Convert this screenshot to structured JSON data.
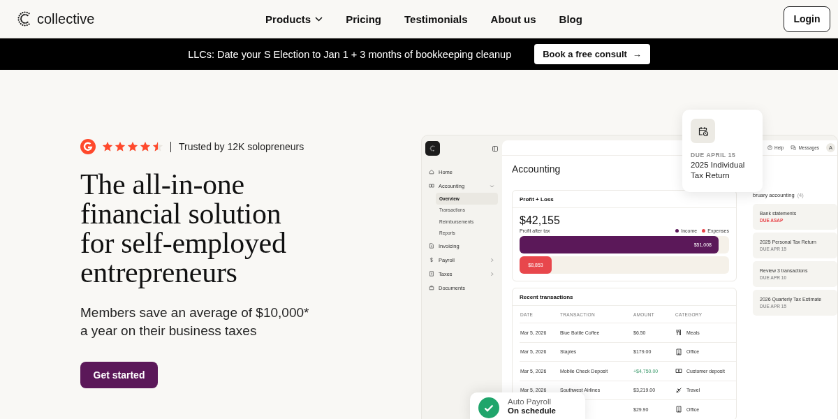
{
  "header": {
    "brand": "collective",
    "nav": [
      {
        "label": "Products",
        "dropdown": true
      },
      {
        "label": "Pricing",
        "dropdown": false
      },
      {
        "label": "Testimonials",
        "dropdown": false
      },
      {
        "label": "About us",
        "dropdown": false
      },
      {
        "label": "Blog",
        "dropdown": false
      }
    ],
    "login": "Login"
  },
  "banner": {
    "text": "LLCs: Date your S Election to Jan 1 + 3 months of bookkeeping cleanup",
    "button": "Book a free consult",
    "arrow": "→"
  },
  "hero": {
    "rating": {
      "stars": 4.5,
      "trust": "Trusted by 12K solopreneurs"
    },
    "title": "The all-in-one financial solution for self-employed entrepreneurs",
    "subtitle": "Members save an average of $10,000* a year on their business taxes",
    "cta": "Get started"
  },
  "app": {
    "sidebar": [
      {
        "label": "Home",
        "selected": false
      },
      {
        "label": "Accounting",
        "selected": false,
        "expanded": true,
        "children": [
          {
            "label": "Overview",
            "selected": true
          },
          {
            "label": "Transactions",
            "selected": false
          },
          {
            "label": "Reimbursements",
            "selected": false
          },
          {
            "label": "Reports",
            "selected": false
          }
        ]
      },
      {
        "label": "Invoicing",
        "selected": false
      },
      {
        "label": "Payroll",
        "selected": false,
        "expanded": false
      },
      {
        "label": "Taxes",
        "selected": false,
        "expanded": false
      },
      {
        "label": "Documents",
        "selected": false
      }
    ],
    "topbar": {
      "help": "Help",
      "messages": "Messages",
      "avatar": "A"
    },
    "page_title": "Accounting",
    "profit_loss": {
      "title": "Profit + Loss",
      "total": "$42,155",
      "caption": "Profit after tax",
      "legend": [
        {
          "label": "Income",
          "color": "#5b1859"
        },
        {
          "label": "Expenses",
          "color": "#e8474c"
        }
      ],
      "bars": [
        {
          "label": "$51,008",
          "level": 0.95
        },
        {
          "label": "$8,853",
          "level": 0.15
        }
      ]
    },
    "transactions": {
      "title": "Recent transactions",
      "columns": [
        "DATE",
        "TRANSACTION",
        "AMOUNT",
        "CATEGORY"
      ],
      "rows": [
        {
          "date": "Mar 5, 2026",
          "transaction": "Blue Bottle Coffee",
          "amount": "$6.50",
          "incoming": false,
          "category": "Meals",
          "kind": "meals"
        },
        {
          "date": "Mar 5, 2026",
          "transaction": "Staples",
          "amount": "$179.00",
          "incoming": false,
          "category": "Office",
          "kind": "office"
        },
        {
          "date": "Mar 5, 2026",
          "transaction": "Mobile Check Deposit",
          "amount": "+$4,750.00",
          "incoming": true,
          "category": "Customer deposit",
          "kind": "deposit"
        },
        {
          "date": "Mar 5, 2026",
          "transaction": "Southwest Airlines",
          "amount": "$3,219.00",
          "incoming": false,
          "category": "Travel",
          "kind": "travel"
        },
        {
          "amount": "$29.90",
          "incoming": false,
          "category": "Office",
          "kind": "office"
        }
      ]
    },
    "tasks": {
      "title": "bruary accounting",
      "count": "(4)",
      "items": [
        {
          "title": "Bank statements",
          "due": "DUE ASAP",
          "urgent": true
        },
        {
          "title": "2025 Personal Tax Return",
          "due": "DUE APR 15",
          "urgent": false
        },
        {
          "title": "Review 3 transactions",
          "due": "DUE APR 10",
          "urgent": false
        },
        {
          "title": "2026 Quarterly Tax Estimate",
          "due": "DUE APR 15",
          "urgent": false
        }
      ]
    },
    "due_card": {
      "label": "DUE APRIL 15",
      "title": "2025 Individual Tax Return"
    },
    "payroll_card": {
      "title": "Auto Payroll",
      "status": "On schedule"
    }
  }
}
